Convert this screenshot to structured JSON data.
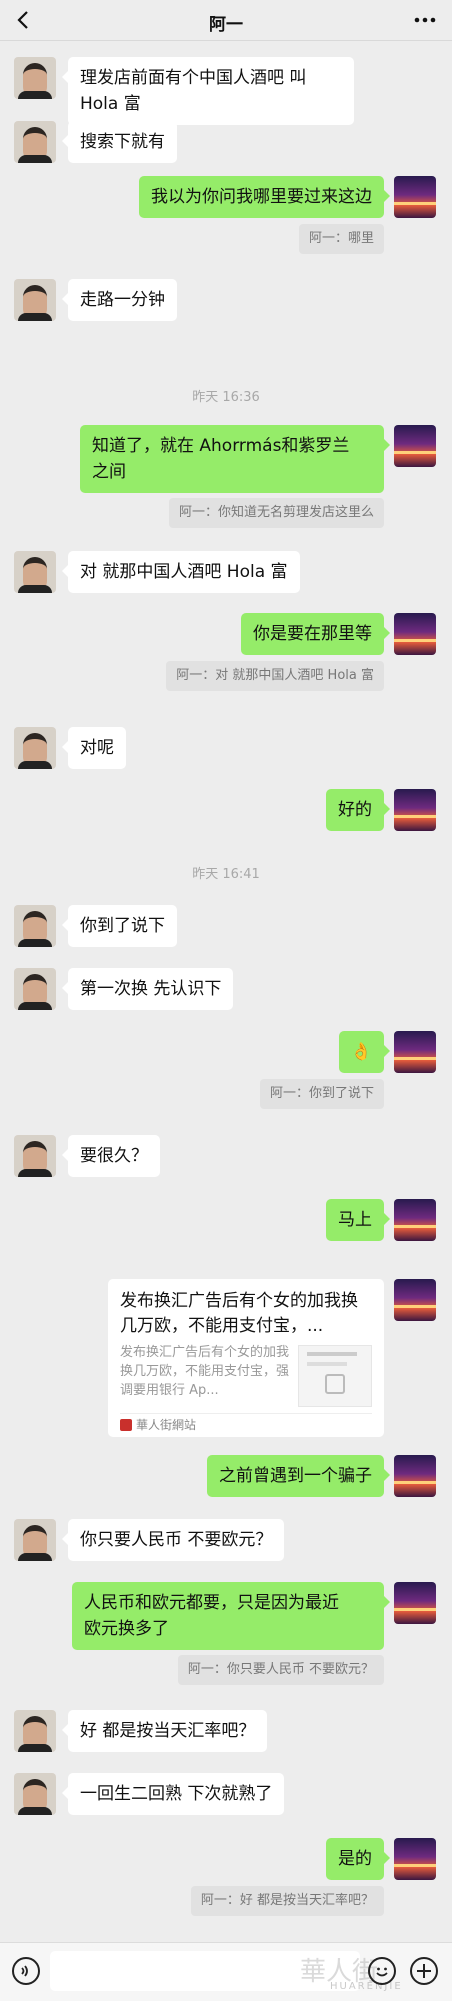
{
  "header": {
    "title": "阿一"
  },
  "messages": [
    {
      "text": "理发店前面有个中国人酒吧 叫\nHola 富"
    },
    {
      "text": "搜索下就有"
    },
    {
      "text": "我以为你问我哪里要过来这边",
      "quote": "阿一：哪里"
    },
    {
      "text": "走路一分钟"
    },
    {
      "time": "昨天 16:36"
    },
    {
      "text": "知道了，就在 Ahorrmás和紫罗兰\n之间",
      "quote": "阿一：你知道无名剪理发店这里么"
    },
    {
      "text": "对 就那中国人酒吧 Hola 富"
    },
    {
      "text": "你是要在那里等",
      "quote": "阿一：对 就那中国人酒吧 Hola 富"
    },
    {
      "text": "对呢"
    },
    {
      "text": "好的"
    },
    {
      "time": "昨天 16:41"
    },
    {
      "text": "你到了说下"
    },
    {
      "text": "第一次换 先认识下"
    },
    {
      "text": "👌",
      "quote": "阿一：你到了说下"
    },
    {
      "text": "要很久？"
    },
    {
      "text": "马上"
    },
    {
      "card_title": "发布换汇广告后有个女的加我换几万欧，不能用支付宝，...",
      "card_desc": "发布换汇广告后有个女的加我换几万欧，不能用支付宝，强调要用银行 Ap...",
      "card_source": "華人街網站"
    },
    {
      "text": "之前曾遇到一个骗子"
    },
    {
      "text": "你只要人民币 不要欧元？"
    },
    {
      "text": "人民币和欧元都要，只是因为最近\n欧元换多了",
      "quote": "阿一：你只要人民币 不要欧元？"
    },
    {
      "text": "好 都是按当天汇率吧？"
    },
    {
      "text": "一回生二回熟 下次就熟了"
    },
    {
      "text": "是的",
      "quote": "阿一：好 都是按当天汇率吧？"
    }
  ],
  "footer": {
    "watermark": "華人街",
    "watermark_sub": "HUARENJIE"
  },
  "icons": {
    "back": "back-chevron-icon",
    "more": "more-dots-icon",
    "voice": "voice-icon",
    "emoji": "emoji-icon",
    "plus": "plus-icon"
  },
  "colors": {
    "background": "#ededed",
    "outgoing_bubble": "#95ec69",
    "incoming_bubble": "#ffffff"
  }
}
